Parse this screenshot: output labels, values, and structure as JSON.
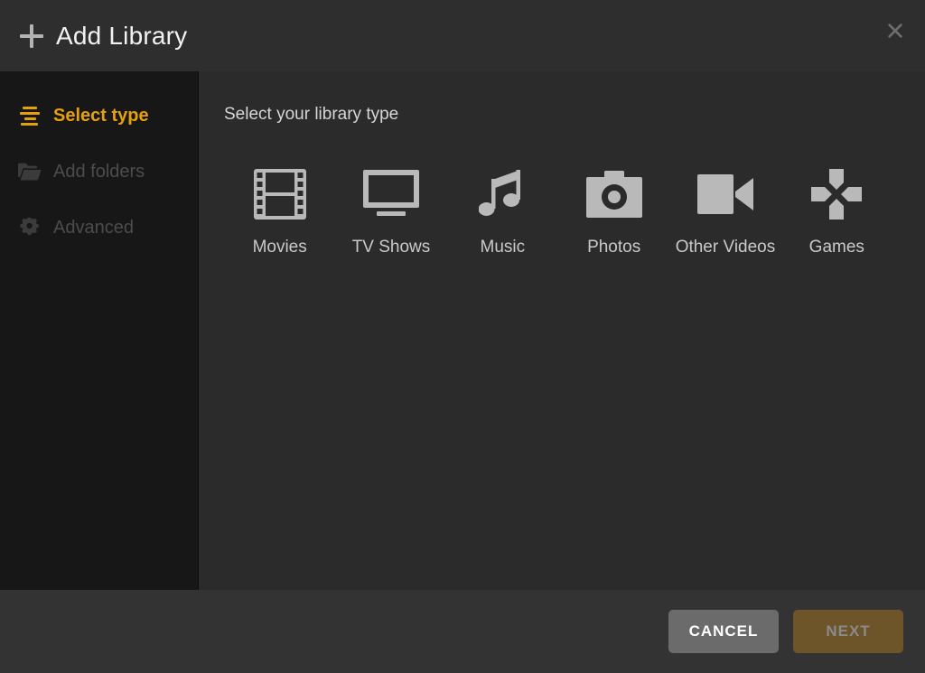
{
  "header": {
    "title": "Add Library",
    "plus_icon": "plus-icon",
    "close_icon": "close-icon"
  },
  "sidebar": {
    "items": [
      {
        "label": "Select type",
        "icon": "list-icon",
        "state": "active"
      },
      {
        "label": "Add folders",
        "icon": "folder-icon",
        "state": "disabled"
      },
      {
        "label": "Advanced",
        "icon": "gear-icon",
        "state": "disabled"
      }
    ]
  },
  "main": {
    "heading": "Select your library type",
    "types": [
      {
        "label": "Movies",
        "icon": "film-strip-icon"
      },
      {
        "label": "TV Shows",
        "icon": "television-icon"
      },
      {
        "label": "Music",
        "icon": "music-note-icon"
      },
      {
        "label": "Photos",
        "icon": "camera-icon"
      },
      {
        "label": "Other Videos",
        "icon": "video-camera-icon"
      },
      {
        "label": "Games",
        "icon": "dpad-icon"
      }
    ]
  },
  "footer": {
    "cancel_label": "CANCEL",
    "next_label": "NEXT"
  },
  "colors": {
    "accent": "#e5a00d",
    "header_bg": "#2e2e2e",
    "sidebar_bg": "#171717",
    "main_bg": "#2b2b2b",
    "footer_bg": "#333333",
    "cancel_bg": "#6b6b6b",
    "next_bg": "#6e5429",
    "icon_grey": "#b3b3b3"
  }
}
